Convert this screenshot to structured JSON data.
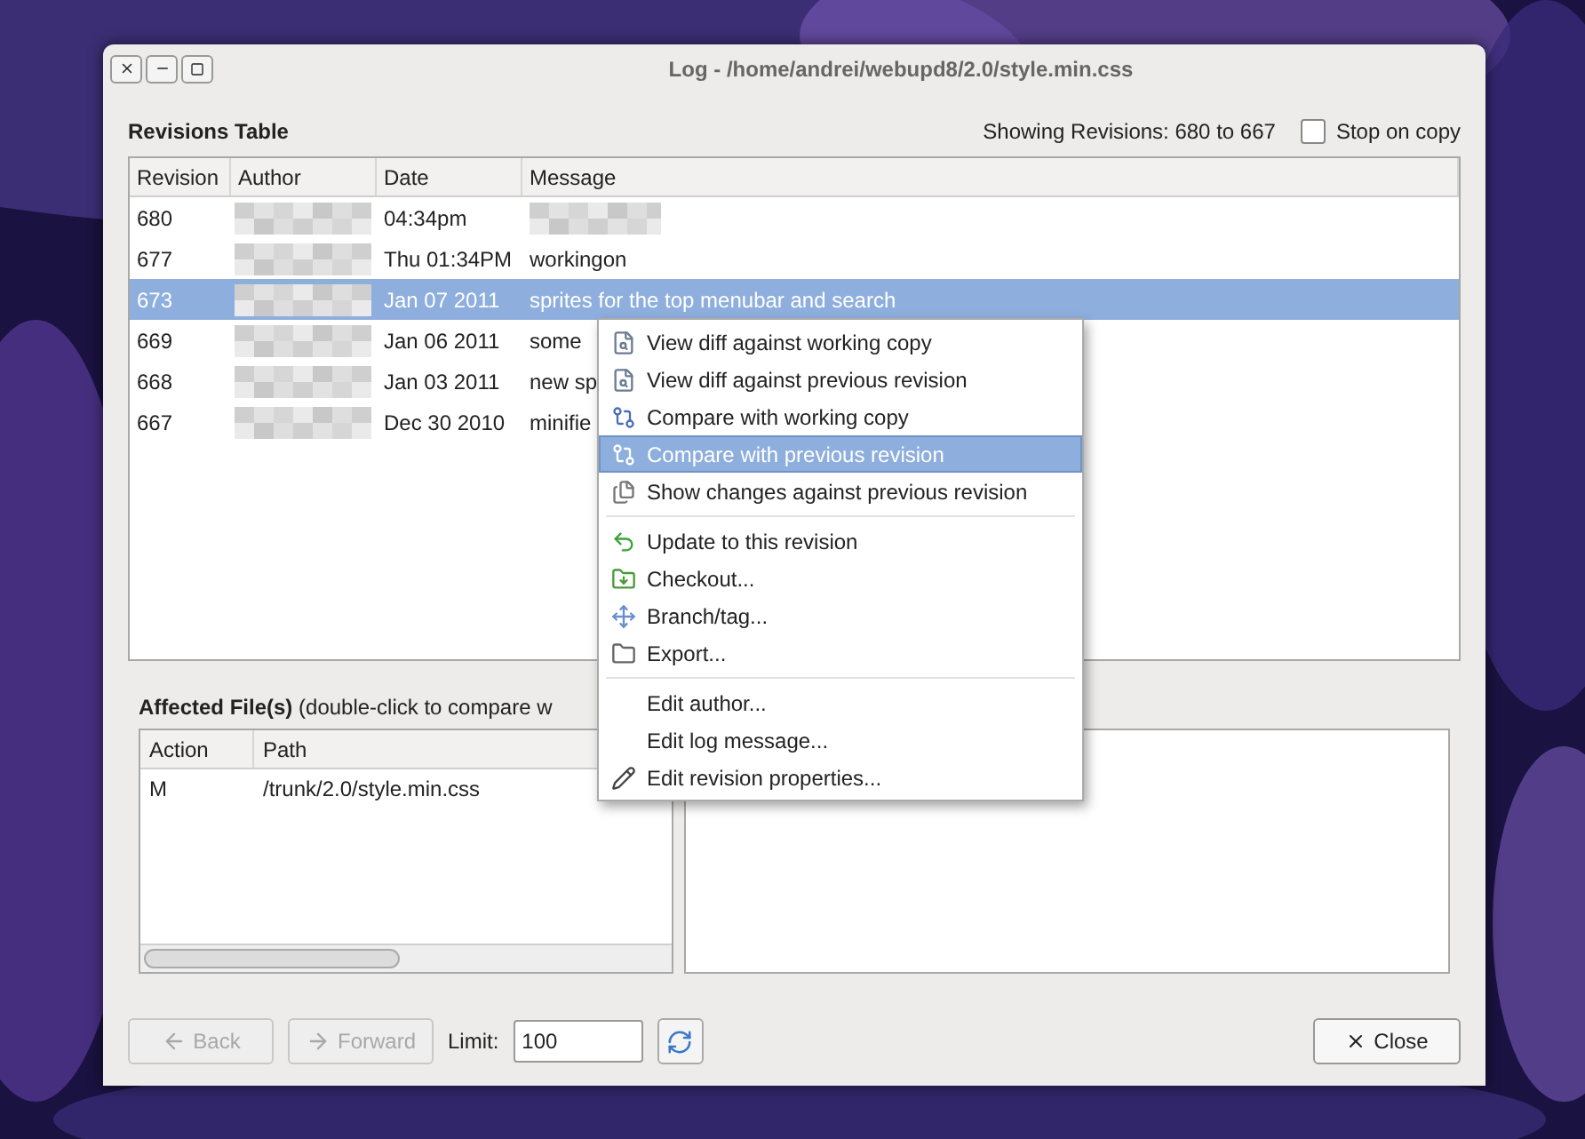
{
  "window": {
    "title": "Log - /home/andrei/webupd8/2.0/style.min.css"
  },
  "revisions": {
    "title": "Revisions Table",
    "showing": "Showing Revisions: 680 to 667",
    "stop_on_copy": {
      "label": "Stop on copy",
      "checked": false
    },
    "columns": [
      "Revision",
      "Author",
      "Date",
      "Message"
    ],
    "rows": [
      {
        "revision": "680",
        "date": "04:34pm",
        "message_redacted": true,
        "selected": false
      },
      {
        "revision": "677",
        "date": "Thu 01:34PM",
        "message": "workingon",
        "selected": false
      },
      {
        "revision": "673",
        "date": "Jan 07 2011",
        "message": "sprites for the top menubar and search",
        "selected": true
      },
      {
        "revision": "669",
        "date": "Jan 06 2011",
        "message": "some",
        "selected": false
      },
      {
        "revision": "668",
        "date": "Jan 03 2011",
        "message": "new sp",
        "selected": false
      },
      {
        "revision": "667",
        "date": "Dec 30 2010",
        "message": "minifie",
        "selected": false
      }
    ]
  },
  "context_menu": [
    {
      "kind": "item",
      "label": "View diff against working copy",
      "selected": false
    },
    {
      "kind": "item",
      "label": "View diff against previous revision",
      "selected": false
    },
    {
      "kind": "item",
      "label": "Compare with working copy",
      "selected": false
    },
    {
      "kind": "item",
      "label": "Compare with previous revision",
      "selected": true
    },
    {
      "kind": "item",
      "label": "Show changes against previous revision",
      "selected": false
    },
    {
      "kind": "separator"
    },
    {
      "kind": "item",
      "label": "Update to this revision",
      "selected": false
    },
    {
      "kind": "item",
      "label": "Checkout...",
      "selected": false
    },
    {
      "kind": "item",
      "label": "Branch/tag...",
      "selected": false
    },
    {
      "kind": "item",
      "label": "Export...",
      "selected": false
    },
    {
      "kind": "separator"
    },
    {
      "kind": "item",
      "label": "Edit author...",
      "selected": false
    },
    {
      "kind": "item",
      "label": "Edit log message...",
      "selected": false
    },
    {
      "kind": "item",
      "label": "Edit revision properties...",
      "selected": false
    }
  ],
  "affected": {
    "label": "**Affected File(s)** (double-click to compare w",
    "columns": [
      "Action",
      "Path"
    ],
    "rows": [
      {
        "action": "M",
        "path": "/trunk/2.0/style.min.css"
      }
    ]
  },
  "footer": {
    "back": {
      "label": "Back",
      "disabled": true
    },
    "forward": {
      "label": "Forward",
      "disabled": true
    },
    "limit_label": "Limit:",
    "limit_value": "100",
    "close": "Close"
  }
}
